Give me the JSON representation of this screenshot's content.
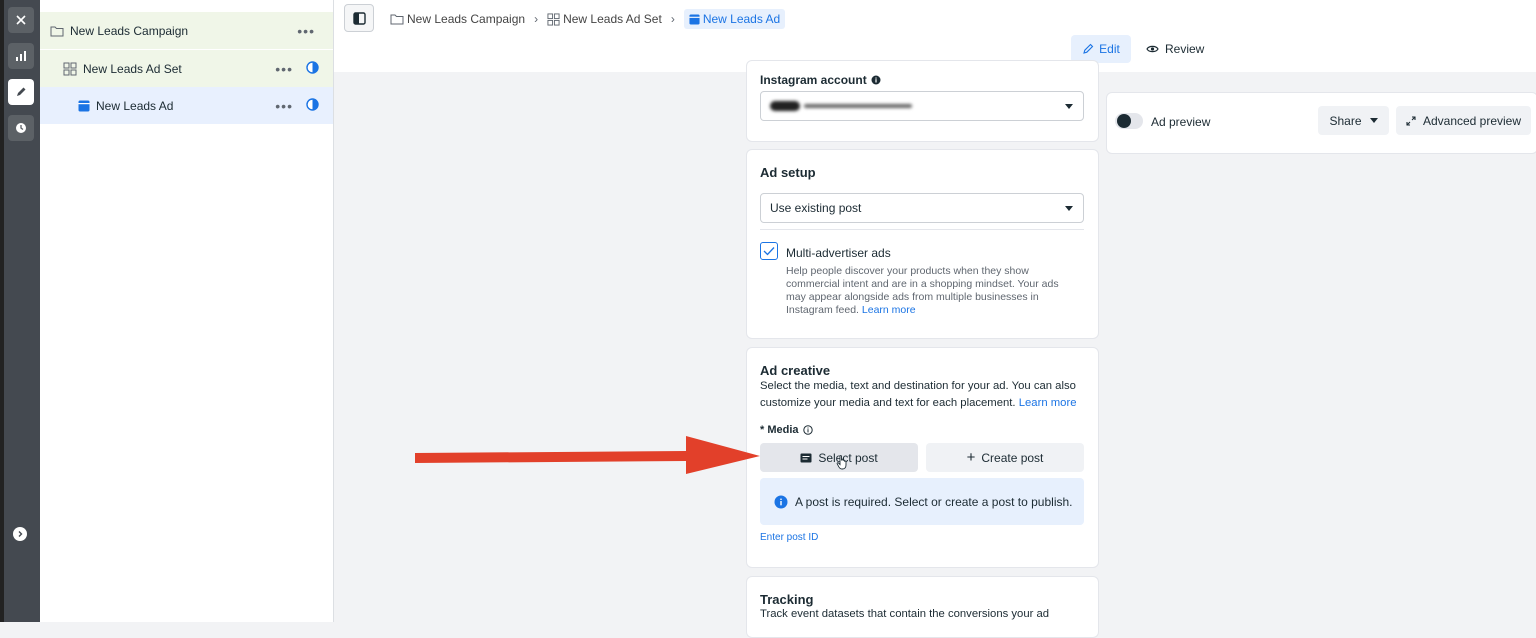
{
  "tree": {
    "campaign": {
      "label": "New Leads Campaign",
      "more": "•••"
    },
    "adset": {
      "label": "New Leads Ad Set",
      "more": "•••"
    },
    "ad": {
      "label": "New Leads Ad",
      "more": "•••"
    }
  },
  "breadcrumb": {
    "campaign": "New Leads Campaign",
    "adset": "New Leads Ad Set",
    "ad": "New Leads Ad"
  },
  "modes": {
    "edit": "Edit",
    "review": "Review"
  },
  "instagram": {
    "label": "Instagram account"
  },
  "ad_setup": {
    "title": "Ad setup",
    "select_value": "Use existing post",
    "multi_label": "Multi-advertiser ads",
    "multi_checked": true,
    "multi_desc": "Help people discover your products when they show commercial intent and are in a shopping mindset. Your ads may appear alongside ads from multiple businesses in Instagram feed.",
    "learn_more": "Learn more"
  },
  "ad_creative": {
    "title": "Ad creative",
    "desc": "Select the media, text and destination for your ad. You can also customize your media and text for each placement.",
    "learn_more": "Learn more",
    "media_label": "* Media",
    "select_post": "Select post",
    "create_post": "Create post",
    "notice": "A post is required. Select or create a post to publish.",
    "enter_post_id": "Enter post ID"
  },
  "tracking": {
    "title": "Tracking",
    "desc": "Track event datasets that contain the conversions your ad"
  },
  "preview": {
    "label": "Ad preview",
    "share": "Share",
    "advanced": "Advanced preview"
  },
  "colors": {
    "accent": "#1b74e4",
    "arrow": "#e2402a",
    "rail": "#444950"
  }
}
